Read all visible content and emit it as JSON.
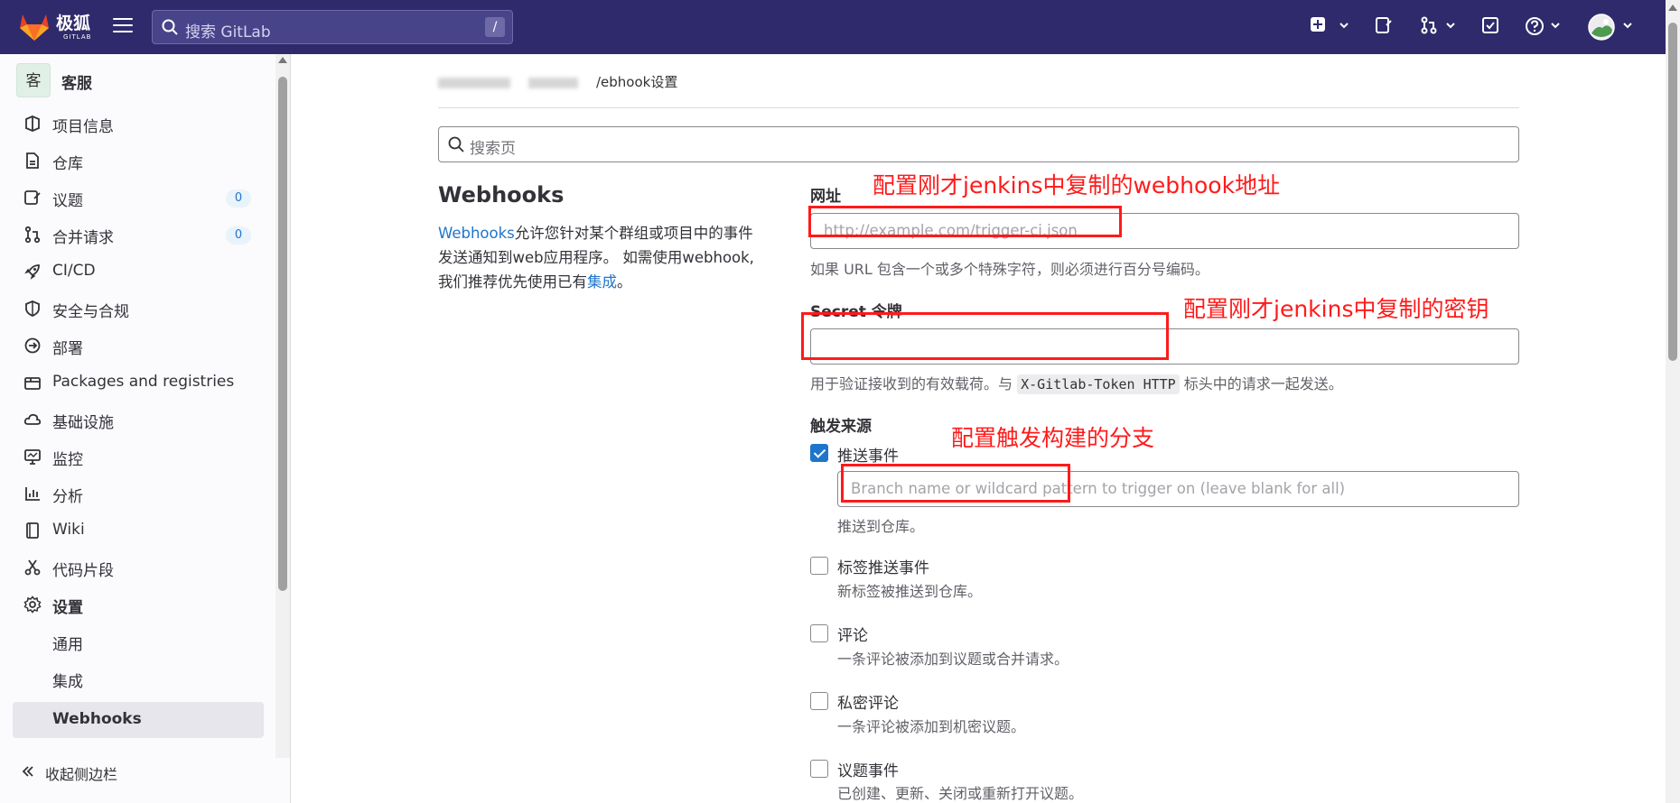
{
  "topbar": {
    "logo_text": "极狐",
    "logo_sub": "GITLAB",
    "search_placeholder": "搜索 GitLab",
    "search_shortcut": "/"
  },
  "sidebar": {
    "project_avatar": "客",
    "project_name": "客服",
    "items": [
      {
        "label": "项目信息",
        "icon": "project-info-icon"
      },
      {
        "label": "仓库",
        "icon": "repository-icon"
      },
      {
        "label": "议题",
        "icon": "issues-icon",
        "badge": "0"
      },
      {
        "label": "合并请求",
        "icon": "merge-request-icon",
        "badge": "0"
      },
      {
        "label": "CI/CD",
        "icon": "rocket-icon"
      },
      {
        "label": "安全与合规",
        "icon": "shield-icon"
      },
      {
        "label": "部署",
        "icon": "deployments-icon"
      },
      {
        "label": "Packages and registries",
        "icon": "package-icon"
      },
      {
        "label": "基础设施",
        "icon": "cloud-icon"
      },
      {
        "label": "监控",
        "icon": "monitor-icon"
      },
      {
        "label": "分析",
        "icon": "chart-icon"
      },
      {
        "label": "Wiki",
        "icon": "book-icon"
      },
      {
        "label": "代码片段",
        "icon": "snippet-icon"
      },
      {
        "label": "设置",
        "icon": "gear-icon"
      }
    ],
    "settings_sub": [
      "通用",
      "集成",
      "Webhooks"
    ],
    "collapse_label": "收起侧边栏"
  },
  "breadcrumb": {
    "current": "/ebhook设置"
  },
  "page_search": {
    "placeholder": "搜索页"
  },
  "webhooks": {
    "title": "Webhooks",
    "desc_link": "Webhooks",
    "desc_text": "允许您针对某个群组或项目中的事件发送通知到web应用程序。 如需使用webhook,我们推荐优先使用已有",
    "desc_link2": "集成",
    "desc_end": "。"
  },
  "form": {
    "url_label": "网址",
    "url_placeholder": "http://example.com/trigger-ci.json",
    "url_help": "如果 URL 包含一个或多个特殊字符，则必须进行百分号编码。",
    "secret_label": "Secret 令牌",
    "secret_help_pre": "用于验证接收到的有效载荷。与",
    "secret_help_code": "X-Gitlab-Token HTTP",
    "secret_help_post": "标头中的请求一起发送。",
    "trigger_label": "触发来源",
    "triggers": [
      {
        "label": "推送事件",
        "checked": true,
        "help": "推送到仓库。"
      },
      {
        "label": "标签推送事件",
        "checked": false,
        "help": "新标签被推送到仓库。"
      },
      {
        "label": "评论",
        "checked": false,
        "help": "一条评论被添加到议题或合并请求。"
      },
      {
        "label": "私密评论",
        "checked": false,
        "help": "一条评论被添加到机密议题。"
      },
      {
        "label": "议题事件",
        "checked": false,
        "help": "已创建、更新、关闭或重新打开议题。"
      }
    ],
    "branch_placeholder": "Branch name or wildcard pattern to trigger on (leave blank for all)"
  },
  "annotations": {
    "url": "配置刚才jenkins中复制的webhook地址",
    "secret": "配置刚才jenkins中复制的密钥",
    "branch": "配置触发构建的分支",
    "color": "#ff1a1a"
  }
}
